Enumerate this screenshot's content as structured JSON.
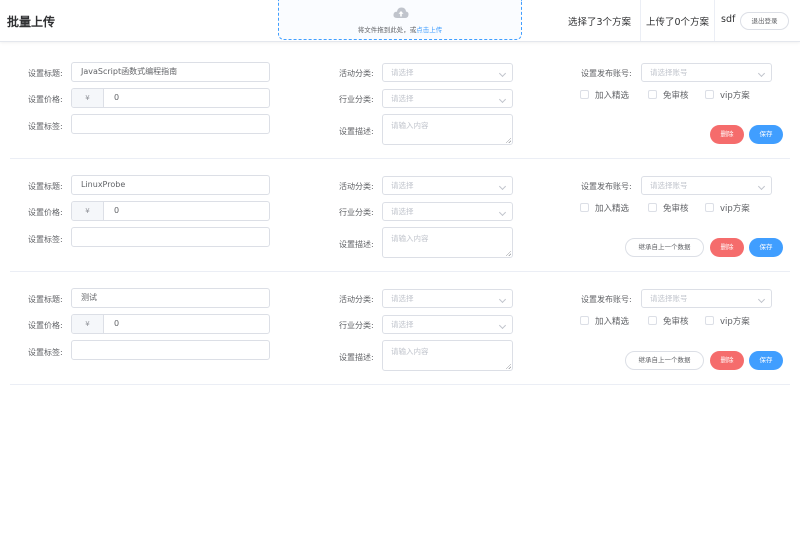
{
  "header": {
    "title": "批量上传",
    "upload_text": "将文件拖到此处，或",
    "upload_link": "点击上传",
    "selected_count": "选择了3个方案",
    "uploaded_count": "上传了0个方案",
    "username": "sdf",
    "logout_label": "退出登录"
  },
  "labels": {
    "title": "设置标题:",
    "price": "设置价格:",
    "tags": "设置标签:",
    "activity": "活动分类:",
    "industry": "行业分类:",
    "desc": "设置描述:",
    "account": "设置发布账号:",
    "featured": "加入精选",
    "no_review": "免审核",
    "vip": "vip方案",
    "delete": "删除",
    "save": "保存",
    "inherit": "继承自上一个数据"
  },
  "placeholders": {
    "select": "请选择",
    "account": "请选择账号",
    "textarea": "请输入内容"
  },
  "items": [
    {
      "title": "JavaScript函数式编程指南",
      "price_prefix": "¥",
      "price": "0",
      "tags": ""
    },
    {
      "title": "LinuxProbe",
      "price_prefix": "¥",
      "price": "0",
      "tags": ""
    },
    {
      "title": "测试",
      "price_prefix": "¥",
      "price": "0",
      "tags": ""
    }
  ]
}
